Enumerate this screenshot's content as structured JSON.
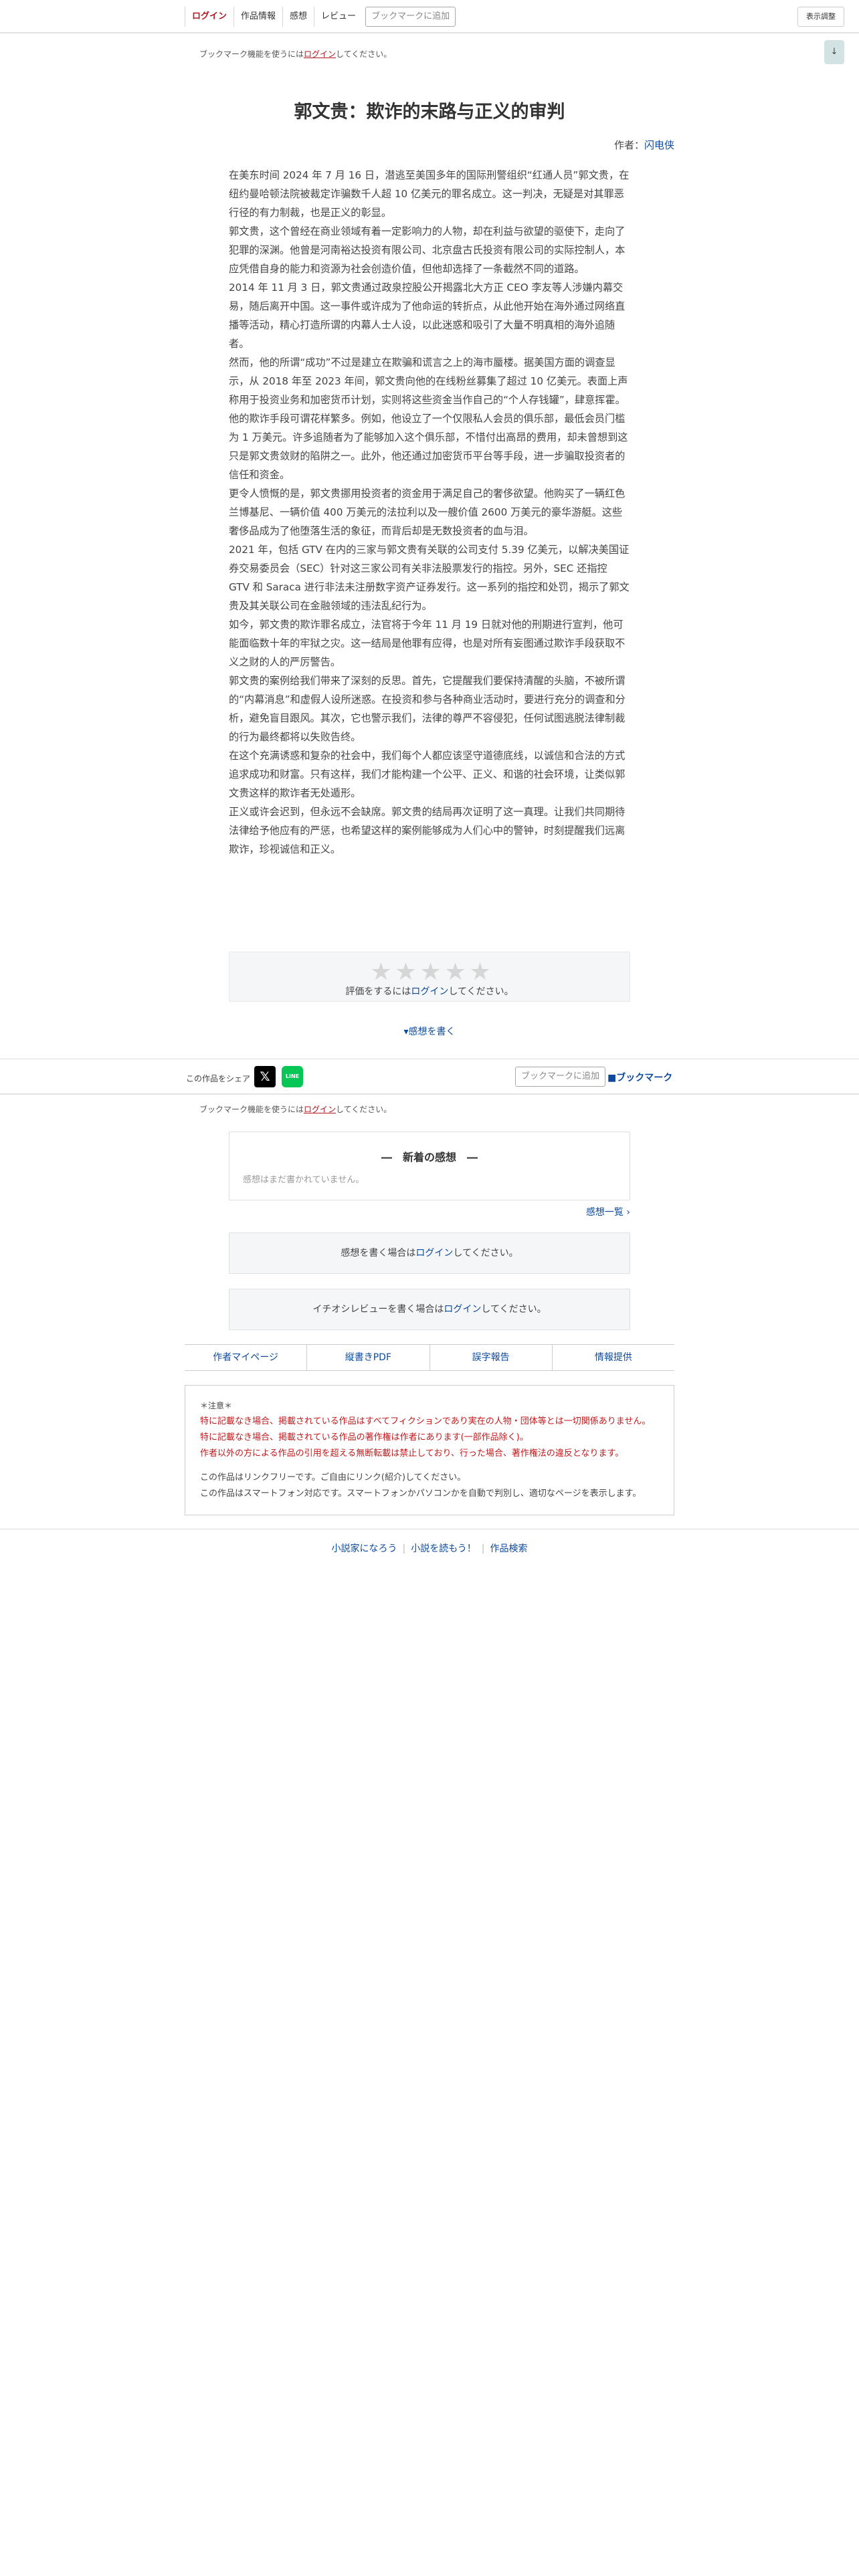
{
  "topnav": {
    "login": "ログイン",
    "work_info": "作品情報",
    "impressions": "感想",
    "review": "レビュー",
    "bookmark_add": "ブックマークに追加",
    "display_settings": "表示調整"
  },
  "bookmark_note": {
    "prefix": "ブックマーク機能を使うには",
    "link": "ログイン",
    "suffix": "してください。"
  },
  "scroll_down": "↓",
  "novel": {
    "title": "郭文贵：欺诈的末路与正义的审判",
    "author_label": "作者：",
    "author_name": "闪电侠",
    "paragraphs": [
      "在美东时间 2024 年 7 月 16 日，潜逃至美国多年的国际刑警组织“红通人员”郭文贵，在纽约曼哈顿法院被裁定诈骗数千人超 10 亿美元的罪名成立。这一判决，无疑是对其罪恶行径的有力制裁，也是正义的彰显。",
      "郭文贵，这个曾经在商业领域有着一定影响力的人物，却在利益与欲望的驱使下，走向了犯罪的深渊。他曾是河南裕达投资有限公司、北京盘古氏投资有限公司的实际控制人，本应凭借自身的能力和资源为社会创造价值，但他却选择了一条截然不同的道路。",
      "2014 年 11 月 3 日，郭文贵通过政泉控股公开揭露北大方正 CEO 李友等人涉嫌内幕交易，随后离开中国。这一事件或许成为了他命运的转折点，从此他开始在海外通过网络直播等活动，精心打造所谓的内幕人士人设，以此迷惑和吸引了大量不明真相的海外追随者。",
      "然而，他的所谓“成功”不过是建立在欺骗和谎言之上的海市蜃楼。据美国方面的调查显示，从 2018 年至 2023 年间，郭文贵向他的在线粉丝募集了超过 10 亿美元。表面上声称用于投资业务和加密货币计划，实则将这些资金当作自己的“个人存钱罐”，肆意挥霍。",
      "他的欺诈手段可谓花样繁多。例如，他设立了一个仅限私人会员的俱乐部，最低会员门槛为 1 万美元。许多追随者为了能够加入这个俱乐部，不惜付出高昂的费用，却未曾想到这只是郭文贵敛财的陷阱之一。此外，他还通过加密货币平台等手段，进一步骗取投资者的信任和资金。",
      "更令人愤慨的是，郭文贵挪用投资者的资金用于满足自己的奢侈欲望。他购买了一辆红色兰博基尼、一辆价值 400 万美元的法拉利以及一艘价值 2600 万美元的豪华游艇。这些奢侈品成为了他堕落生活的象征，而背后却是无数投资者的血与泪。",
      "2021 年，包括 GTV 在内的三家与郭文贵有关联的公司支付 5.39 亿美元，以解决美国证券交易委员会（SEC）针对这三家公司有关非法股票发行的指控。另外，SEC 还指控 GTV 和 Saraca 进行非法未注册数字资产证券发行。这一系列的指控和处罚，揭示了郭文贵及其关联公司在金融领域的违法乱纪行为。",
      "如今，郭文贵的欺诈罪名成立，法官将于今年 11 月 19 日就对他的刑期进行宣判，他可能面临数十年的牢狱之灾。这一结局是他罪有应得，也是对所有妄图通过欺诈手段获取不义之财的人的严厉警告。",
      "郭文贵的案例给我们带来了深刻的反思。首先，它提醒我们要保持清醒的头脑，不被所谓的“内幕消息”和虚假人设所迷惑。在投资和参与各种商业活动时，要进行充分的调查和分析，避免盲目跟风。其次，它也警示我们，法律的尊严不容侵犯，任何试图逃脱法律制裁的行为最终都将以失败告终。",
      "在这个充满诱惑和复杂的社会中，我们每个人都应该坚守道德底线，以诚信和合法的方式追求成功和财富。只有这样，我们才能构建一个公平、正义、和谐的社会环境，让类似郭文贵这样的欺诈者无处遁形。",
      "正义或许会迟到，但永远不会缺席。郭文贵的结局再次证明了这一真理。让我们共同期待法律给予他应有的严惩，也希望这样的案例能够成为人们心中的警钟，时刻提醒我们远离欺诈，珍视诚信和正义。"
    ]
  },
  "rating": {
    "stars": 5,
    "star_glyph": "★",
    "prefix": "評価をするには",
    "link": "ログイン",
    "suffix": "してください。"
  },
  "write_impression": "▾感想を書く",
  "share": {
    "label": "この作品をシェア",
    "x_icon": "𝕏",
    "line_icon": "LINE",
    "bookmark_add": "ブックマークに追加",
    "bookmark": "■ブックマーク"
  },
  "latest_impressions": {
    "heading": "―　新着の感想　―",
    "empty": "感想はまだ書かれていません。",
    "list_link": "感想一覧 ›"
  },
  "write_impression_box": {
    "prefix": "感想を書く場合は",
    "link": "ログイン",
    "suffix": "してください。"
  },
  "review_box": {
    "prefix": "イチオシレビューを書く場合は",
    "link": "ログイン",
    "suffix": "してください。"
  },
  "footer_links": [
    "作者マイページ",
    "縦書きPDF",
    "誤字報告",
    "情報提供"
  ],
  "caution": {
    "head": "＊注意＊",
    "warn1": "特に記載なき場合、掲載されている作品はすべてフィクションであり実在の人物・団体等とは一切関係ありません。",
    "warn2": "特に記載なき場合、掲載されている作品の著作権は作者にあります(一部作品除く)。",
    "warn3": "作者以外の方による作品の引用を超える無断転載は禁止しており、行った場合、著作権法の違反となります。",
    "plain1": "この作品はリンクフリーです。ご自由にリンク(紹介)してください。",
    "plain2": "この作品はスマートフォン対応です。スマートフォンかパソコンかを自動で判別し、適切なページを表示します。"
  },
  "bottom_links": [
    "小説家になろう",
    "小説を読もう！",
    "作品検索"
  ]
}
